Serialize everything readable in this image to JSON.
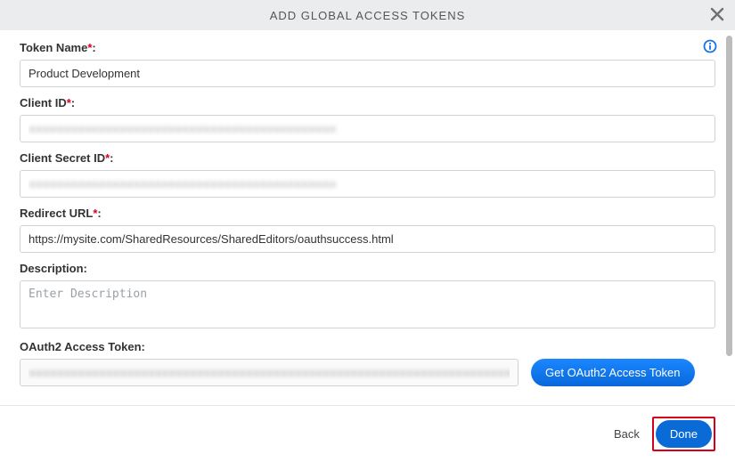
{
  "header": {
    "title": "ADD GLOBAL ACCESS TOKENS"
  },
  "info_icon": "info",
  "fields": {
    "token_name": {
      "label": "Token Name",
      "required": true,
      "value": "Product Development"
    },
    "client_id": {
      "label": "Client ID",
      "required": true,
      "value": "●●●●●●●●●●●●●●●●●●●●●●●●●●●●●●●●●●●●●●●●●●●●"
    },
    "client_secret": {
      "label": "Client Secret ID",
      "required": true,
      "value": "●●●●●●●●●●●●●●●●●●●●●●●●●●●●●●●●●●●●●●●●●●●●"
    },
    "redirect_url": {
      "label": "Redirect URL",
      "required": true,
      "value": "https://mysite.com/SharedResources/SharedEditors/oauthsuccess.html"
    },
    "description": {
      "label": "Description",
      "required": false,
      "placeholder": "Enter Description",
      "value": ""
    },
    "oauth_token": {
      "label": "OAuth2 Access Token",
      "required": false,
      "value": "●●●●●●●●●●●●●●●●●●●●●●●●●●●●●●●●●●●●●●●●●●●●●●●●●●●●●●●●●●●●●●●●●●●●●●●●●●●●●●●●●"
    }
  },
  "buttons": {
    "get_token": "Get OAuth2 Access Token",
    "back": "Back",
    "done": "Done"
  },
  "required_marker": "*",
  "colon": ":"
}
